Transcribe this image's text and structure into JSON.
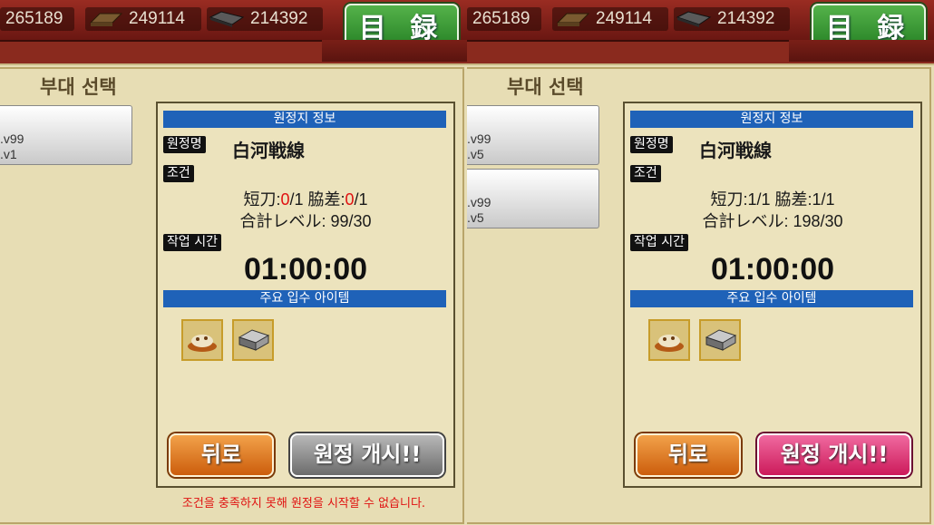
{
  "screens": [
    {
      "resources": [
        "265189",
        "249114",
        "214392"
      ],
      "catalog_label": "目 録",
      "section_title": "부대 선택",
      "unit_cards": [
        {
          "line1": ".v99",
          "line2": ".v1"
        }
      ],
      "info_header": "원정지 정보",
      "dest_tag": "원정명",
      "dest_name": "白河戦線",
      "cond_tag": "조건",
      "cond1_a_label": "短刀:",
      "cond1_a_have": "0",
      "cond1_a_need": "/1",
      "cond1_b_label": " 脇差:",
      "cond1_b_have": "0",
      "cond1_b_need": "/1",
      "cond2": "合計レベル: 99/30",
      "time_tag": "작업 시간",
      "time": "01:00:00",
      "items_header": "주요 입수 아이템",
      "items": [
        "food-icon",
        "steel-icon"
      ],
      "back_label": "뒤로",
      "start_label": "원정 개시!!",
      "start_enabled": false,
      "warning": "조건을 충족하지 못해 원정을 시작할 수 없습니다."
    },
    {
      "resources": [
        "265189",
        "249114",
        "214392"
      ],
      "catalog_label": "目 録",
      "section_title": "부대 선택",
      "unit_cards": [
        {
          "line1": ".v99",
          "line2": ".v5"
        },
        {
          "line1": ".v99",
          "line2": ".v5"
        }
      ],
      "info_header": "원정지 정보",
      "dest_tag": "원정명",
      "dest_name": "白河戦線",
      "cond_tag": "조건",
      "cond1_a_label": "短刀:",
      "cond1_a_have": "1",
      "cond1_a_need": "/1",
      "cond1_b_label": " 脇差:",
      "cond1_b_have": "1",
      "cond1_b_need": "/1",
      "cond2": "合計レベル: 198/30",
      "time_tag": "작업 시간",
      "time": "01:00:00",
      "items_header": "주요 입수 아이템",
      "items": [
        "food-icon",
        "steel-icon"
      ],
      "back_label": "뒤로",
      "start_label": "원정 개시!!",
      "start_enabled": true,
      "warning": ""
    }
  ],
  "colors": {
    "accent_blue": "#1f62b8",
    "error_red": "#e01010",
    "start_pink": "#cc1a5a"
  }
}
